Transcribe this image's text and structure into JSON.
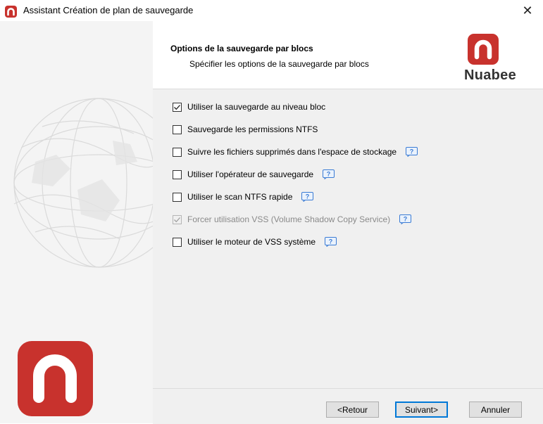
{
  "window": {
    "title": "Assistant Création de plan de sauvegarde",
    "close_glyph": "✕",
    "icon": "nuabee-app-icon"
  },
  "header": {
    "title": "Options de la sauvegarde par blocs",
    "subtitle": "Spécifier les options de la sauvegarde par blocs",
    "brand_name": "Nuabee"
  },
  "options": [
    {
      "label": "Utiliser la sauvegarde au niveau bloc",
      "checked": true,
      "enabled": true,
      "help": false
    },
    {
      "label": "Sauvegarde les permissions NTFS",
      "checked": false,
      "enabled": true,
      "help": false
    },
    {
      "label": "Suivre les fichiers supprimés dans l'espace de stockage",
      "checked": false,
      "enabled": true,
      "help": true
    },
    {
      "label": "Utiliser l'opérateur de sauvegarde",
      "checked": false,
      "enabled": true,
      "help": true
    },
    {
      "label": "Utiliser le scan NTFS rapide",
      "checked": false,
      "enabled": true,
      "help": true
    },
    {
      "label": "Forcer utilisation VSS (Volume Shadow Copy Service)",
      "checked": true,
      "enabled": false,
      "help": true
    },
    {
      "label": "Utiliser le moteur de VSS système",
      "checked": false,
      "enabled": true,
      "help": true
    }
  ],
  "footer": {
    "back_label": "<Retour",
    "next_label": "Suivant>",
    "cancel_label": "Annuler"
  },
  "colors": {
    "brand_red": "#c8322d",
    "accent_blue": "#0078d7",
    "help_blue": "#3a7bd5"
  },
  "icons": {
    "help": "question-mark-bubble-icon",
    "checkbox": "checkbox-icon"
  }
}
